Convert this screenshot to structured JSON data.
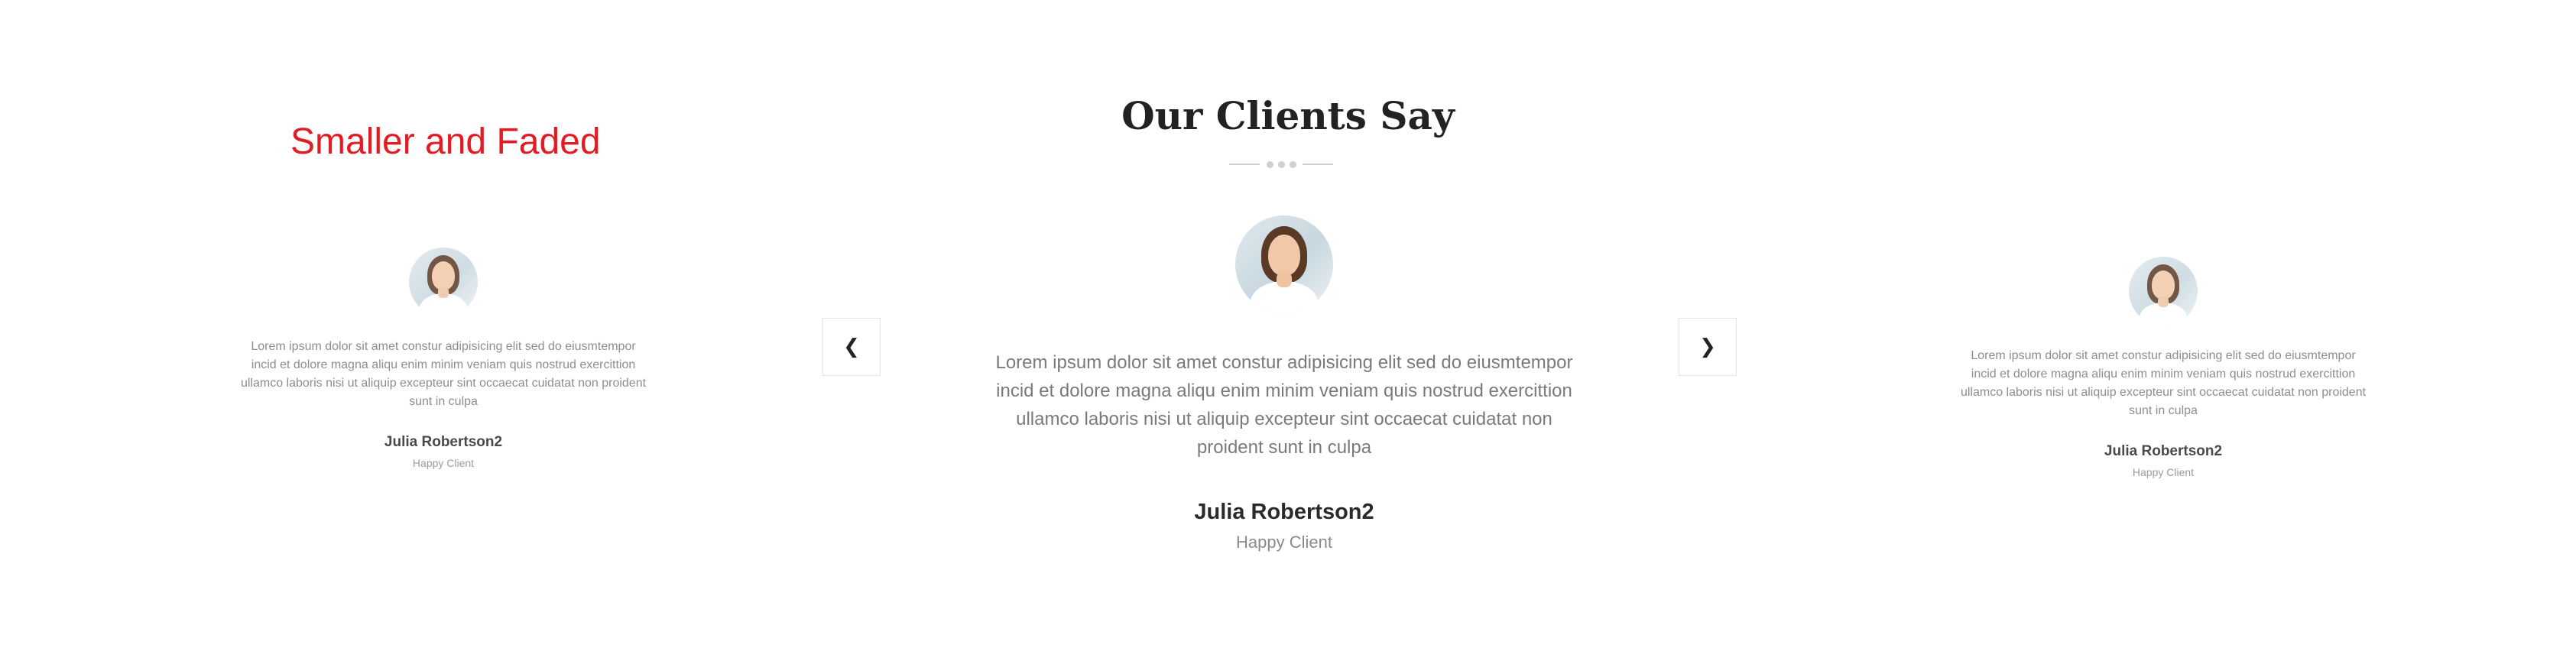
{
  "annotation": {
    "text": "Smaller and Faded",
    "color": "#e31b23"
  },
  "section": {
    "title": "Our Clients Say"
  },
  "navigation": {
    "prev_icon": "chevron-left-icon",
    "next_icon": "chevron-right-icon",
    "prev_glyph": "❮",
    "next_glyph": "❯"
  },
  "testimonials": [
    {
      "position": "left",
      "quote": "Lorem ipsum dolor sit amet constur adipisicing elit sed do eiusmtempor incid et dolore magna aliqu enim minim veniam quis nostrud exercittion ullamco laboris nisi ut aliquip excepteur sint occaecat cuidatat non proident sunt in culpa",
      "name": "Julia Robertson2",
      "role": "Happy Client"
    },
    {
      "position": "center",
      "quote": "Lorem ipsum dolor sit amet constur adipisicing elit sed do eiusmtempor incid et dolore magna aliqu enim minim veniam quis nostrud exercittion ullamco laboris nisi ut aliquip excepteur sint occaecat cuidatat non proident sunt in culpa",
      "name": "Julia Robertson2",
      "role": "Happy Client"
    },
    {
      "position": "right",
      "quote": "Lorem ipsum dolor sit amet constur adipisicing elit sed do eiusmtempor incid et dolore magna aliqu enim minim veniam quis nostrud exercittion ullamco laboris nisi ut aliquip excepteur sint occaecat cuidatat non proident sunt in culpa",
      "name": "Julia Robertson2",
      "role": "Happy Client"
    }
  ]
}
